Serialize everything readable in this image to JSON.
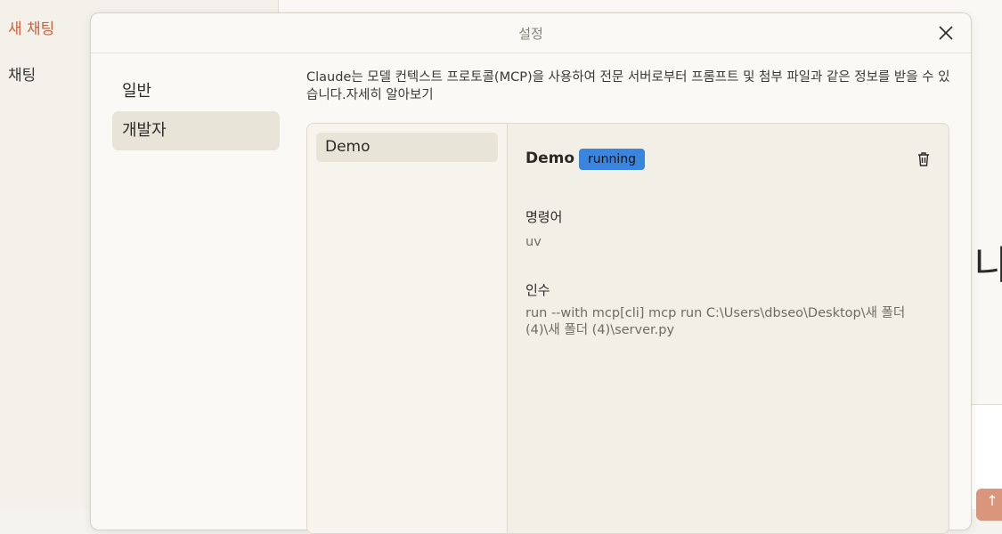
{
  "background": {
    "sidebar": {
      "new_chat": "새 채팅",
      "chats": "채팅"
    },
    "glyph": "나"
  },
  "modal": {
    "title": "설정",
    "nav": [
      {
        "label": "일반",
        "active": false
      },
      {
        "label": "개발자",
        "active": true
      }
    ],
    "description": "Claude는 모델 컨텍스트 프로토콜(MCP)을 사용하여 전문 서버로부터 프롬프트 및 첨부 파일과 같은 정보를 받을 수 있습니다.",
    "learn_more": "자세히 알아보기",
    "servers": [
      {
        "name": "Demo"
      }
    ],
    "selected": {
      "name": "Demo",
      "status": "running",
      "command_label": "명령어",
      "command_value": "uv",
      "args_label": "인수",
      "args_value": "run --with mcp[cli] mcp run C:\\Users\\dbseo\\Desktop\\새 폴더 (4)\\새 폴더 (4)\\server.py"
    }
  },
  "colors": {
    "accent": "#c8643f",
    "badge": "#3a86de"
  }
}
